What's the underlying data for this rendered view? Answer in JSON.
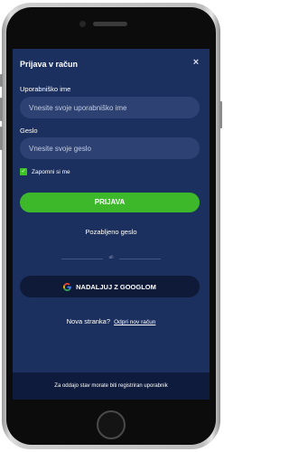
{
  "modal": {
    "title": "Prijava v račun",
    "close_glyph": "×"
  },
  "username": {
    "label": "Uporabniško ime",
    "placeholder": "Vnesite svoje uporabniško ime",
    "value": ""
  },
  "password": {
    "label": "Geslo",
    "placeholder": "Vnesite svoje geslo",
    "value": ""
  },
  "remember_me": {
    "label": "Zapomni si me",
    "checked": true,
    "check_glyph": "✓"
  },
  "login_button": {
    "label": "PRIJAVA"
  },
  "forgot_password": {
    "label": "Pozabljeno geslo"
  },
  "divider": {
    "label": "ali"
  },
  "google_button": {
    "label": "NADALJUJ Z GOOGLOM",
    "icon": "google-icon"
  },
  "register": {
    "prompt": "Nova stranka?",
    "link_label": "Odpri nov račun"
  },
  "footer": {
    "text": "Za oddajo stav morate biti registriran uporabnik"
  },
  "colors": {
    "background": "#1c305f",
    "input": "#2d4272",
    "accent_green": "#3db82a",
    "google_button": "#0e1a37",
    "footer": "#0f1b3c"
  }
}
